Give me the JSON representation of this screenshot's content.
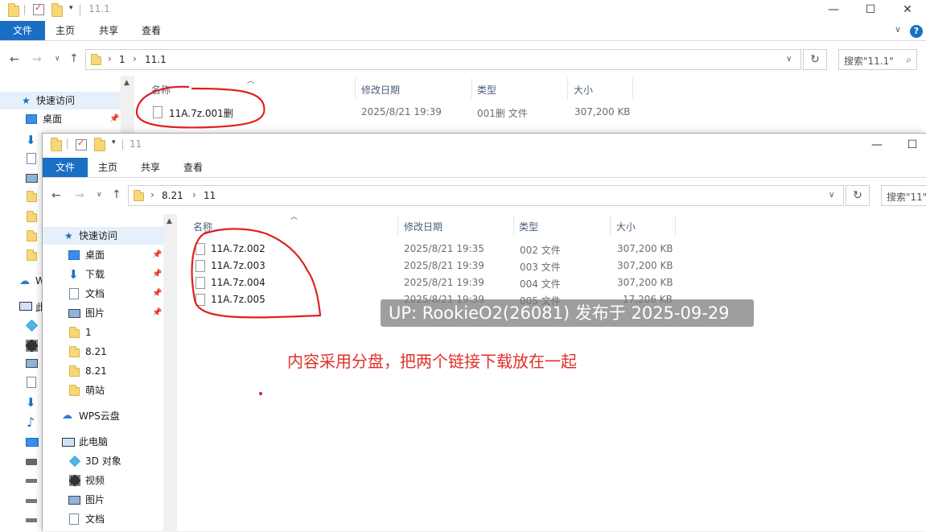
{
  "back": {
    "title": "11.1",
    "ribbon_tabs": [
      "文件",
      "主页",
      "共享",
      "查看"
    ],
    "path": [
      "1",
      "11.1"
    ],
    "search_placeholder": "搜索\"11.1\"",
    "columns": [
      "名称",
      "修改日期",
      "类型",
      "大小"
    ],
    "files": [
      {
        "name": "11A.7z.001删",
        "date": "2025/8/21 19:39",
        "type": "001删 文件",
        "size": "307,200 KB"
      }
    ],
    "sidebar": {
      "quick_access": "快速访问",
      "desktop": "桌面"
    }
  },
  "front": {
    "title": "11",
    "ribbon_tabs": [
      "文件",
      "主页",
      "共享",
      "查看"
    ],
    "path": [
      "8.21",
      "11"
    ],
    "search_placeholder": "搜索\"11\"",
    "columns": [
      "名称",
      "修改日期",
      "类型",
      "大小"
    ],
    "files": [
      {
        "name": "11A.7z.002",
        "date": "2025/8/21 19:35",
        "type": "002 文件",
        "size": "307,200 KB"
      },
      {
        "name": "11A.7z.003",
        "date": "2025/8/21 19:39",
        "type": "003 文件",
        "size": "307,200 KB"
      },
      {
        "name": "11A.7z.004",
        "date": "2025/8/21 19:39",
        "type": "004 文件",
        "size": "307,200 KB"
      },
      {
        "name": "11A.7z.005",
        "date": "2025/8/21 19:39",
        "type": "005 文件",
        "size": "17,206 KB"
      }
    ],
    "sidebar": {
      "quick_access": "快速访问",
      "items": [
        "桌面",
        "下载",
        "文档",
        "图片",
        "1",
        "8.21",
        "8.21",
        "萌站"
      ],
      "wps": "WPS云盘",
      "this_pc": "此电脑",
      "pc_items": [
        "3D 对象",
        "视频",
        "图片",
        "文档"
      ]
    }
  },
  "back_sidebar_partial": {
    "wps_initial": "W",
    "pc_initial": "此"
  },
  "watermark": "UP: RookieO2(26081) 发布于 2025-09-29",
  "annotation": "内容采用分盘，把两个链接下载放在一起",
  "colors": {
    "accent": "#1a6fc4",
    "annotation": "#e02020"
  }
}
